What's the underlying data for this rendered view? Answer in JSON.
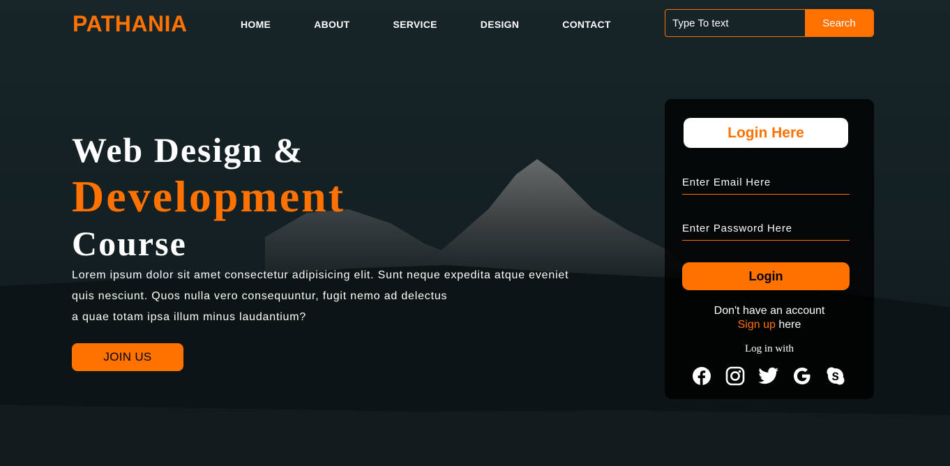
{
  "brand": {
    "name": "PATHANIA",
    "accent": "#ff7200"
  },
  "nav": {
    "items": [
      {
        "label": "HOME"
      },
      {
        "label": "ABOUT"
      },
      {
        "label": "SERVICE"
      },
      {
        "label": "DESIGN"
      },
      {
        "label": "CONTACT"
      }
    ]
  },
  "search": {
    "placeholder": "Type To text",
    "button_label": "Search"
  },
  "hero": {
    "line1": "Web Design &",
    "line2": "Development",
    "line3": "Course",
    "paragraph": [
      "Lorem ipsum dolor sit amet consectetur adipisicing elit. Sunt neque expedita atque eveniet",
      "quis nesciunt. Quos nulla vero consequuntur, fugit nemo ad delectus",
      "a quae totam ipsa illum minus laudantium?"
    ],
    "cta_label": "JOIN US"
  },
  "login": {
    "title": "Login Here",
    "email_placeholder": "Enter Email Here",
    "password_placeholder": "Enter Password Here",
    "button_label": "Login",
    "no_account_text": "Don't have an account",
    "signup_link": "Sign up",
    "signup_suffix": "here",
    "login_with_text": "Log in with",
    "social_icons": [
      "facebook-icon",
      "instagram-icon",
      "twitter-icon",
      "google-icon",
      "skype-icon"
    ]
  }
}
